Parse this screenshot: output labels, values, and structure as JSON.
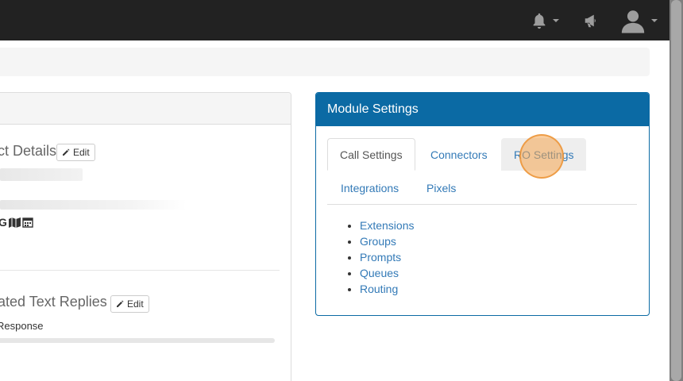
{
  "navbar": {
    "icons": [
      "bell-icon",
      "megaphone-icon",
      "user-icon"
    ]
  },
  "left_panel": {
    "section1_title": "ct Details",
    "section2_title": "ated Text Replies",
    "edit_label": "Edit",
    "icons_row_text": "G",
    "response_label": "Response"
  },
  "module": {
    "title": "Module Settings",
    "tabs": [
      "Call Settings",
      "Connectors",
      "RO Settings",
      "Integrations",
      "Pixels"
    ],
    "active_tab": "Call Settings",
    "items": [
      "Extensions",
      "Groups",
      "Prompts",
      "Queues",
      "Routing"
    ]
  },
  "colors": {
    "navbar": "#222222",
    "accent": "#0b6aa4",
    "link": "#337ab7",
    "click_highlight": "#f5a650"
  }
}
